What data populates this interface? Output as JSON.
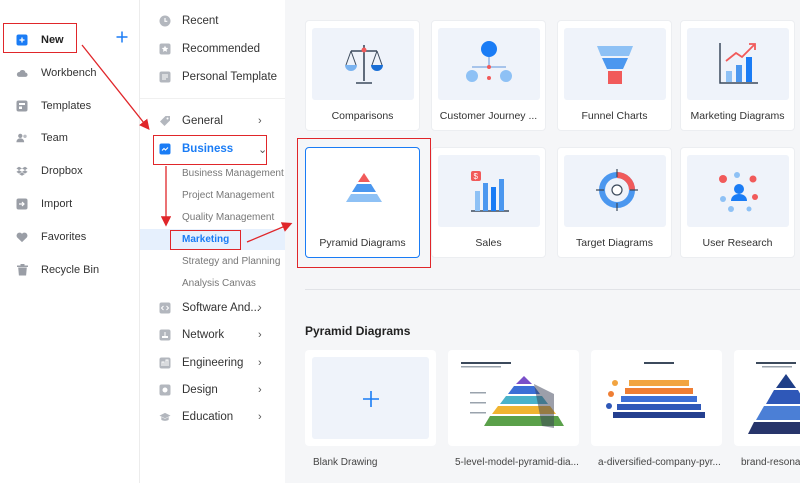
{
  "sidebar": {
    "new_label": "New",
    "items": [
      {
        "label": "Workbench",
        "icon": "cloud-icon"
      },
      {
        "label": "Templates",
        "icon": "templates-icon"
      },
      {
        "label": "Team",
        "icon": "team-icon"
      },
      {
        "label": "Dropbox",
        "icon": "dropbox-icon"
      },
      {
        "label": "Import",
        "icon": "import-icon"
      },
      {
        "label": "Favorites",
        "icon": "heart-icon"
      },
      {
        "label": "Recycle Bin",
        "icon": "trash-icon"
      }
    ]
  },
  "categories": {
    "top": [
      {
        "label": "Recent",
        "icon": "clock-icon"
      },
      {
        "label": "Recommended",
        "icon": "star-icon"
      },
      {
        "label": "Personal Template",
        "icon": "template-icon"
      }
    ],
    "general": "General",
    "business": "Business",
    "business_sub": [
      "Business Management",
      "Project Management",
      "Quality Management",
      "Marketing",
      "Strategy and Planning",
      "Analysis Canvas"
    ],
    "rest": [
      {
        "label": "Software And...",
        "icon": "code-icon"
      },
      {
        "label": "Network",
        "icon": "network-icon"
      },
      {
        "label": "Engineering",
        "icon": "engineering-icon"
      },
      {
        "label": "Design",
        "icon": "design-icon"
      },
      {
        "label": "Education",
        "icon": "education-icon"
      }
    ]
  },
  "diagram_types": [
    "Comparisons",
    "Customer Journey ...",
    "Funnel Charts",
    "Marketing Diagrams",
    "Pyramid Diagrams",
    "Sales",
    "Target Diagrams",
    "User Research"
  ],
  "section_title": "Pyramid Diagrams",
  "templates": [
    "Blank Drawing",
    "5-level-model-pyramid-dia...",
    "a-diversified-company-pyr...",
    "brand-resonan"
  ],
  "colors": {
    "accent": "#1a7cf5",
    "highlight": "#e0262a",
    "selected_bg": "#e6f0fd"
  }
}
